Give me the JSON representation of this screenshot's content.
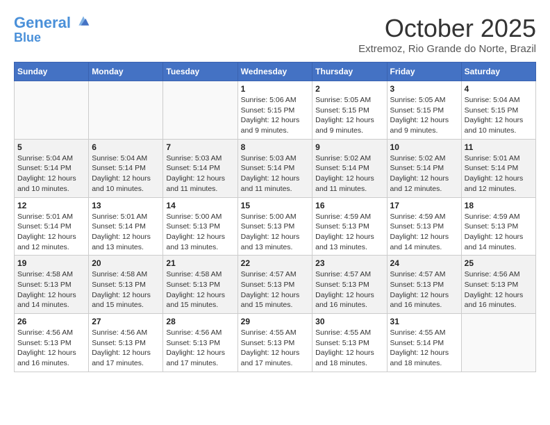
{
  "logo": {
    "line1": "General",
    "line2": "Blue"
  },
  "title": "October 2025",
  "subtitle": "Extremoz, Rio Grande do Norte, Brazil",
  "headers": [
    "Sunday",
    "Monday",
    "Tuesday",
    "Wednesday",
    "Thursday",
    "Friday",
    "Saturday"
  ],
  "weeks": [
    [
      {
        "day": "",
        "info": ""
      },
      {
        "day": "",
        "info": ""
      },
      {
        "day": "",
        "info": ""
      },
      {
        "day": "1",
        "info": "Sunrise: 5:06 AM\nSunset: 5:15 PM\nDaylight: 12 hours and 9 minutes."
      },
      {
        "day": "2",
        "info": "Sunrise: 5:05 AM\nSunset: 5:15 PM\nDaylight: 12 hours and 9 minutes."
      },
      {
        "day": "3",
        "info": "Sunrise: 5:05 AM\nSunset: 5:15 PM\nDaylight: 12 hours and 9 minutes."
      },
      {
        "day": "4",
        "info": "Sunrise: 5:04 AM\nSunset: 5:15 PM\nDaylight: 12 hours and 10 minutes."
      }
    ],
    [
      {
        "day": "5",
        "info": "Sunrise: 5:04 AM\nSunset: 5:14 PM\nDaylight: 12 hours and 10 minutes."
      },
      {
        "day": "6",
        "info": "Sunrise: 5:04 AM\nSunset: 5:14 PM\nDaylight: 12 hours and 10 minutes."
      },
      {
        "day": "7",
        "info": "Sunrise: 5:03 AM\nSunset: 5:14 PM\nDaylight: 12 hours and 11 minutes."
      },
      {
        "day": "8",
        "info": "Sunrise: 5:03 AM\nSunset: 5:14 PM\nDaylight: 12 hours and 11 minutes."
      },
      {
        "day": "9",
        "info": "Sunrise: 5:02 AM\nSunset: 5:14 PM\nDaylight: 12 hours and 11 minutes."
      },
      {
        "day": "10",
        "info": "Sunrise: 5:02 AM\nSunset: 5:14 PM\nDaylight: 12 hours and 12 minutes."
      },
      {
        "day": "11",
        "info": "Sunrise: 5:01 AM\nSunset: 5:14 PM\nDaylight: 12 hours and 12 minutes."
      }
    ],
    [
      {
        "day": "12",
        "info": "Sunrise: 5:01 AM\nSunset: 5:14 PM\nDaylight: 12 hours and 12 minutes."
      },
      {
        "day": "13",
        "info": "Sunrise: 5:01 AM\nSunset: 5:14 PM\nDaylight: 12 hours and 13 minutes."
      },
      {
        "day": "14",
        "info": "Sunrise: 5:00 AM\nSunset: 5:13 PM\nDaylight: 12 hours and 13 minutes."
      },
      {
        "day": "15",
        "info": "Sunrise: 5:00 AM\nSunset: 5:13 PM\nDaylight: 12 hours and 13 minutes."
      },
      {
        "day": "16",
        "info": "Sunrise: 4:59 AM\nSunset: 5:13 PM\nDaylight: 12 hours and 13 minutes."
      },
      {
        "day": "17",
        "info": "Sunrise: 4:59 AM\nSunset: 5:13 PM\nDaylight: 12 hours and 14 minutes."
      },
      {
        "day": "18",
        "info": "Sunrise: 4:59 AM\nSunset: 5:13 PM\nDaylight: 12 hours and 14 minutes."
      }
    ],
    [
      {
        "day": "19",
        "info": "Sunrise: 4:58 AM\nSunset: 5:13 PM\nDaylight: 12 hours and 14 minutes."
      },
      {
        "day": "20",
        "info": "Sunrise: 4:58 AM\nSunset: 5:13 PM\nDaylight: 12 hours and 15 minutes."
      },
      {
        "day": "21",
        "info": "Sunrise: 4:58 AM\nSunset: 5:13 PM\nDaylight: 12 hours and 15 minutes."
      },
      {
        "day": "22",
        "info": "Sunrise: 4:57 AM\nSunset: 5:13 PM\nDaylight: 12 hours and 15 minutes."
      },
      {
        "day": "23",
        "info": "Sunrise: 4:57 AM\nSunset: 5:13 PM\nDaylight: 12 hours and 16 minutes."
      },
      {
        "day": "24",
        "info": "Sunrise: 4:57 AM\nSunset: 5:13 PM\nDaylight: 12 hours and 16 minutes."
      },
      {
        "day": "25",
        "info": "Sunrise: 4:56 AM\nSunset: 5:13 PM\nDaylight: 12 hours and 16 minutes."
      }
    ],
    [
      {
        "day": "26",
        "info": "Sunrise: 4:56 AM\nSunset: 5:13 PM\nDaylight: 12 hours and 16 minutes."
      },
      {
        "day": "27",
        "info": "Sunrise: 4:56 AM\nSunset: 5:13 PM\nDaylight: 12 hours and 17 minutes."
      },
      {
        "day": "28",
        "info": "Sunrise: 4:56 AM\nSunset: 5:13 PM\nDaylight: 12 hours and 17 minutes."
      },
      {
        "day": "29",
        "info": "Sunrise: 4:55 AM\nSunset: 5:13 PM\nDaylight: 12 hours and 17 minutes."
      },
      {
        "day": "30",
        "info": "Sunrise: 4:55 AM\nSunset: 5:13 PM\nDaylight: 12 hours and 18 minutes."
      },
      {
        "day": "31",
        "info": "Sunrise: 4:55 AM\nSunset: 5:14 PM\nDaylight: 12 hours and 18 minutes."
      },
      {
        "day": "",
        "info": ""
      }
    ]
  ]
}
